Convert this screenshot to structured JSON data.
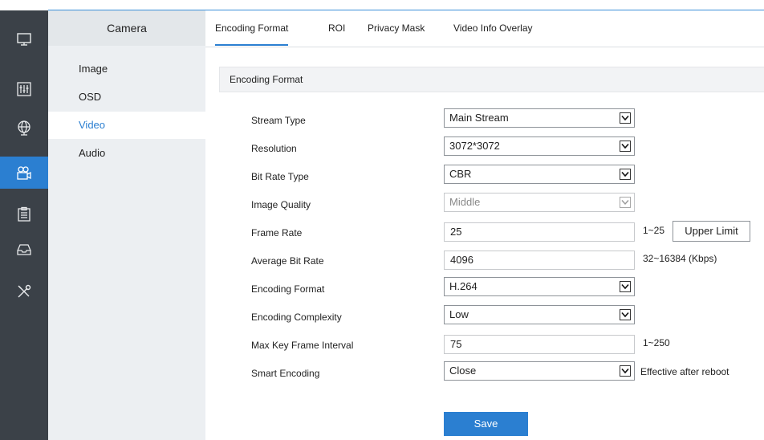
{
  "left_icons": [
    {
      "name": "monitor-icon"
    },
    {
      "name": "sliders-icon"
    },
    {
      "name": "globe-icon"
    },
    {
      "name": "camera-icon",
      "active": true
    },
    {
      "name": "clipboard-icon"
    },
    {
      "name": "storage-icon"
    },
    {
      "name": "tools-icon"
    }
  ],
  "subnav": {
    "title": "Camera",
    "items": [
      "Image",
      "OSD",
      "Video",
      "Audio"
    ],
    "active": "Video"
  },
  "tabs": [
    "Encoding Format",
    "ROI",
    "Privacy Mask",
    "Video Info Overlay"
  ],
  "active_tab": "Encoding Format",
  "section_title": "Encoding Format",
  "form": {
    "stream_type": {
      "label": "Stream Type",
      "value": "Main Stream"
    },
    "resolution": {
      "label": "Resolution",
      "value": "3072*3072"
    },
    "bit_rate_type": {
      "label": "Bit Rate Type",
      "value": "CBR"
    },
    "image_quality": {
      "label": "Image Quality",
      "value": "Middle",
      "disabled": true
    },
    "frame_rate": {
      "label": "Frame Rate",
      "value": "25",
      "hint": "1~25",
      "button": "Upper Limit"
    },
    "average_bit_rate": {
      "label": "Average Bit Rate",
      "value": "4096",
      "hint": "32~16384 (Kbps)"
    },
    "encoding_format": {
      "label": "Encoding Format",
      "value": "H.264"
    },
    "encoding_complexity": {
      "label": "Encoding Complexity",
      "value": "Low"
    },
    "max_key_frame_interval": {
      "label": "Max Key Frame Interval",
      "value": "75",
      "hint": "1~250"
    },
    "smart_encoding": {
      "label": "Smart Encoding",
      "value": "Close",
      "hint": "Effective after reboot"
    }
  },
  "save_label": "Save",
  "colors": {
    "accent": "#2b7fd1",
    "sidebar": "#3b4148",
    "subnav": "#eceff2"
  }
}
